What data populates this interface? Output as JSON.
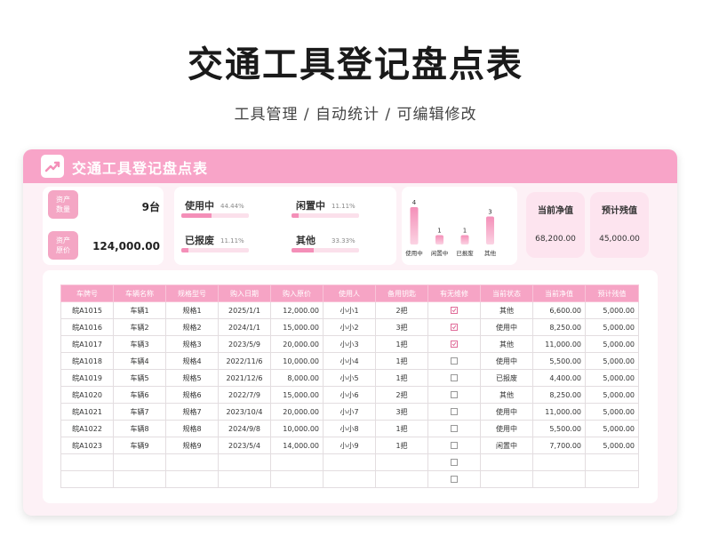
{
  "page": {
    "title": "交通工具登记盘点表",
    "subtitle": "工具管理 /  自动统计 /  可编辑修改"
  },
  "card": {
    "title": "交通工具登记盘点表"
  },
  "summary": {
    "count_label": [
      "资产",
      "数量"
    ],
    "count_value": "9台",
    "price_label": [
      "资产",
      "原价"
    ],
    "price_value": "124,000.00"
  },
  "status_stats": [
    {
      "label": "使用中",
      "percent": "44.44%",
      "fraction": 0.4444
    },
    {
      "label": "闲置中",
      "percent": "11.11%",
      "fraction": 0.1111
    },
    {
      "label": "已报废",
      "percent": "11.11%",
      "fraction": 0.1111
    },
    {
      "label": "其他",
      "percent": "33.33%",
      "fraction": 0.3333
    }
  ],
  "chart_data": {
    "type": "bar",
    "categories": [
      "使用中",
      "闲置中",
      "已报废",
      "其他"
    ],
    "values": [
      4,
      1,
      1,
      3
    ],
    "ylim": [
      0,
      4
    ],
    "colors": {
      "bar_top": "#f48fb8",
      "bar_bottom": "#fbd3e3"
    }
  },
  "finance": [
    {
      "label": "当前净值",
      "value": "68,200.00"
    },
    {
      "label": "预计残值",
      "value": "45,000.00"
    }
  ],
  "table": {
    "headers": [
      "车牌号",
      "车辆名称",
      "规格型号",
      "购入日期",
      "购入原价",
      "使用人",
      "备用钥匙",
      "有无维修",
      "当前状态",
      "当前净值",
      "预计残值"
    ],
    "rows": [
      [
        "皖A1015",
        "车辆1",
        "规格1",
        "2025/1/1",
        "12,000.00",
        "小小1",
        "2把",
        "☑",
        "其他",
        "6,600.00",
        "5,000.00"
      ],
      [
        "皖A1016",
        "车辆2",
        "规格2",
        "2024/1/1",
        "15,000.00",
        "小小2",
        "3把",
        "☑",
        "使用中",
        "8,250.00",
        "5,000.00"
      ],
      [
        "皖A1017",
        "车辆3",
        "规格3",
        "2023/5/9",
        "20,000.00",
        "小小3",
        "1把",
        "☑",
        "其他",
        "11,000.00",
        "5,000.00"
      ],
      [
        "皖A1018",
        "车辆4",
        "规格4",
        "2022/11/6",
        "10,000.00",
        "小小4",
        "1把",
        "☐",
        "使用中",
        "5,500.00",
        "5,000.00"
      ],
      [
        "皖A1019",
        "车辆5",
        "规格5",
        "2021/12/6",
        "8,000.00",
        "小小5",
        "1把",
        "☐",
        "已报废",
        "4,400.00",
        "5,000.00"
      ],
      [
        "皖A1020",
        "车辆6",
        "规格6",
        "2022/7/9",
        "15,000.00",
        "小小6",
        "2把",
        "☐",
        "其他",
        "8,250.00",
        "5,000.00"
      ],
      [
        "皖A1021",
        "车辆7",
        "规格7",
        "2023/10/4",
        "20,000.00",
        "小小7",
        "3把",
        "☐",
        "使用中",
        "11,000.00",
        "5,000.00"
      ],
      [
        "皖A1022",
        "车辆8",
        "规格8",
        "2024/9/8",
        "10,000.00",
        "小小8",
        "1把",
        "☐",
        "使用中",
        "5,500.00",
        "5,000.00"
      ],
      [
        "皖A1023",
        "车辆9",
        "规格9",
        "2023/5/4",
        "14,000.00",
        "小小9",
        "1把",
        "☐",
        "闲置中",
        "7,700.00",
        "5,000.00"
      ],
      [
        "",
        "",
        "",
        "",
        "",
        "",
        "",
        "☐",
        "",
        "",
        ""
      ],
      [
        "",
        "",
        "",
        "",
        "",
        "",
        "",
        "☐",
        "",
        "",
        ""
      ]
    ]
  },
  "colors": {
    "accent": "#f8a4c8",
    "badge": "#f4a6c4",
    "card_bg": "#fdf1f6",
    "fin_bg": "#fde4ef"
  }
}
